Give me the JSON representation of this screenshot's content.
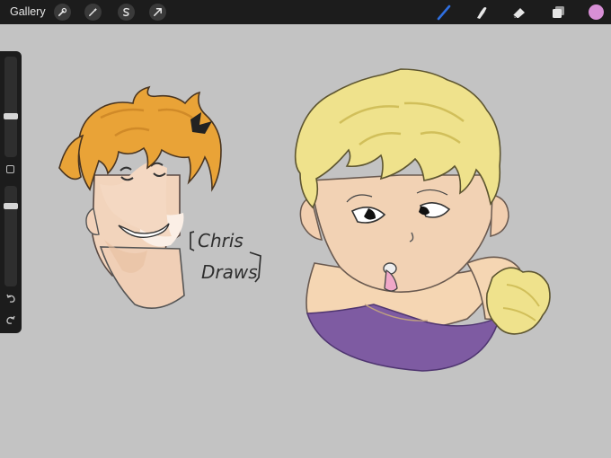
{
  "topbar": {
    "gallery_label": "Gallery",
    "left_tools": [
      "wrench-icon",
      "magic-wand-icon",
      "selection-s-icon",
      "transform-arrow-icon"
    ],
    "right_tools": [
      "brush-icon",
      "smudge-icon",
      "eraser-icon",
      "layers-icon"
    ],
    "brush_color": "#2f6fe0",
    "current_color": "#d88fd6"
  },
  "sidebar": {
    "brush_size": 0.4,
    "opacity": 0.82,
    "undo_icon": "undo-icon",
    "redo_icon": "redo-icon"
  },
  "canvas": {
    "background": "#c3c3c3",
    "signature_line1": "Chris",
    "signature_line2": "Draws"
  }
}
